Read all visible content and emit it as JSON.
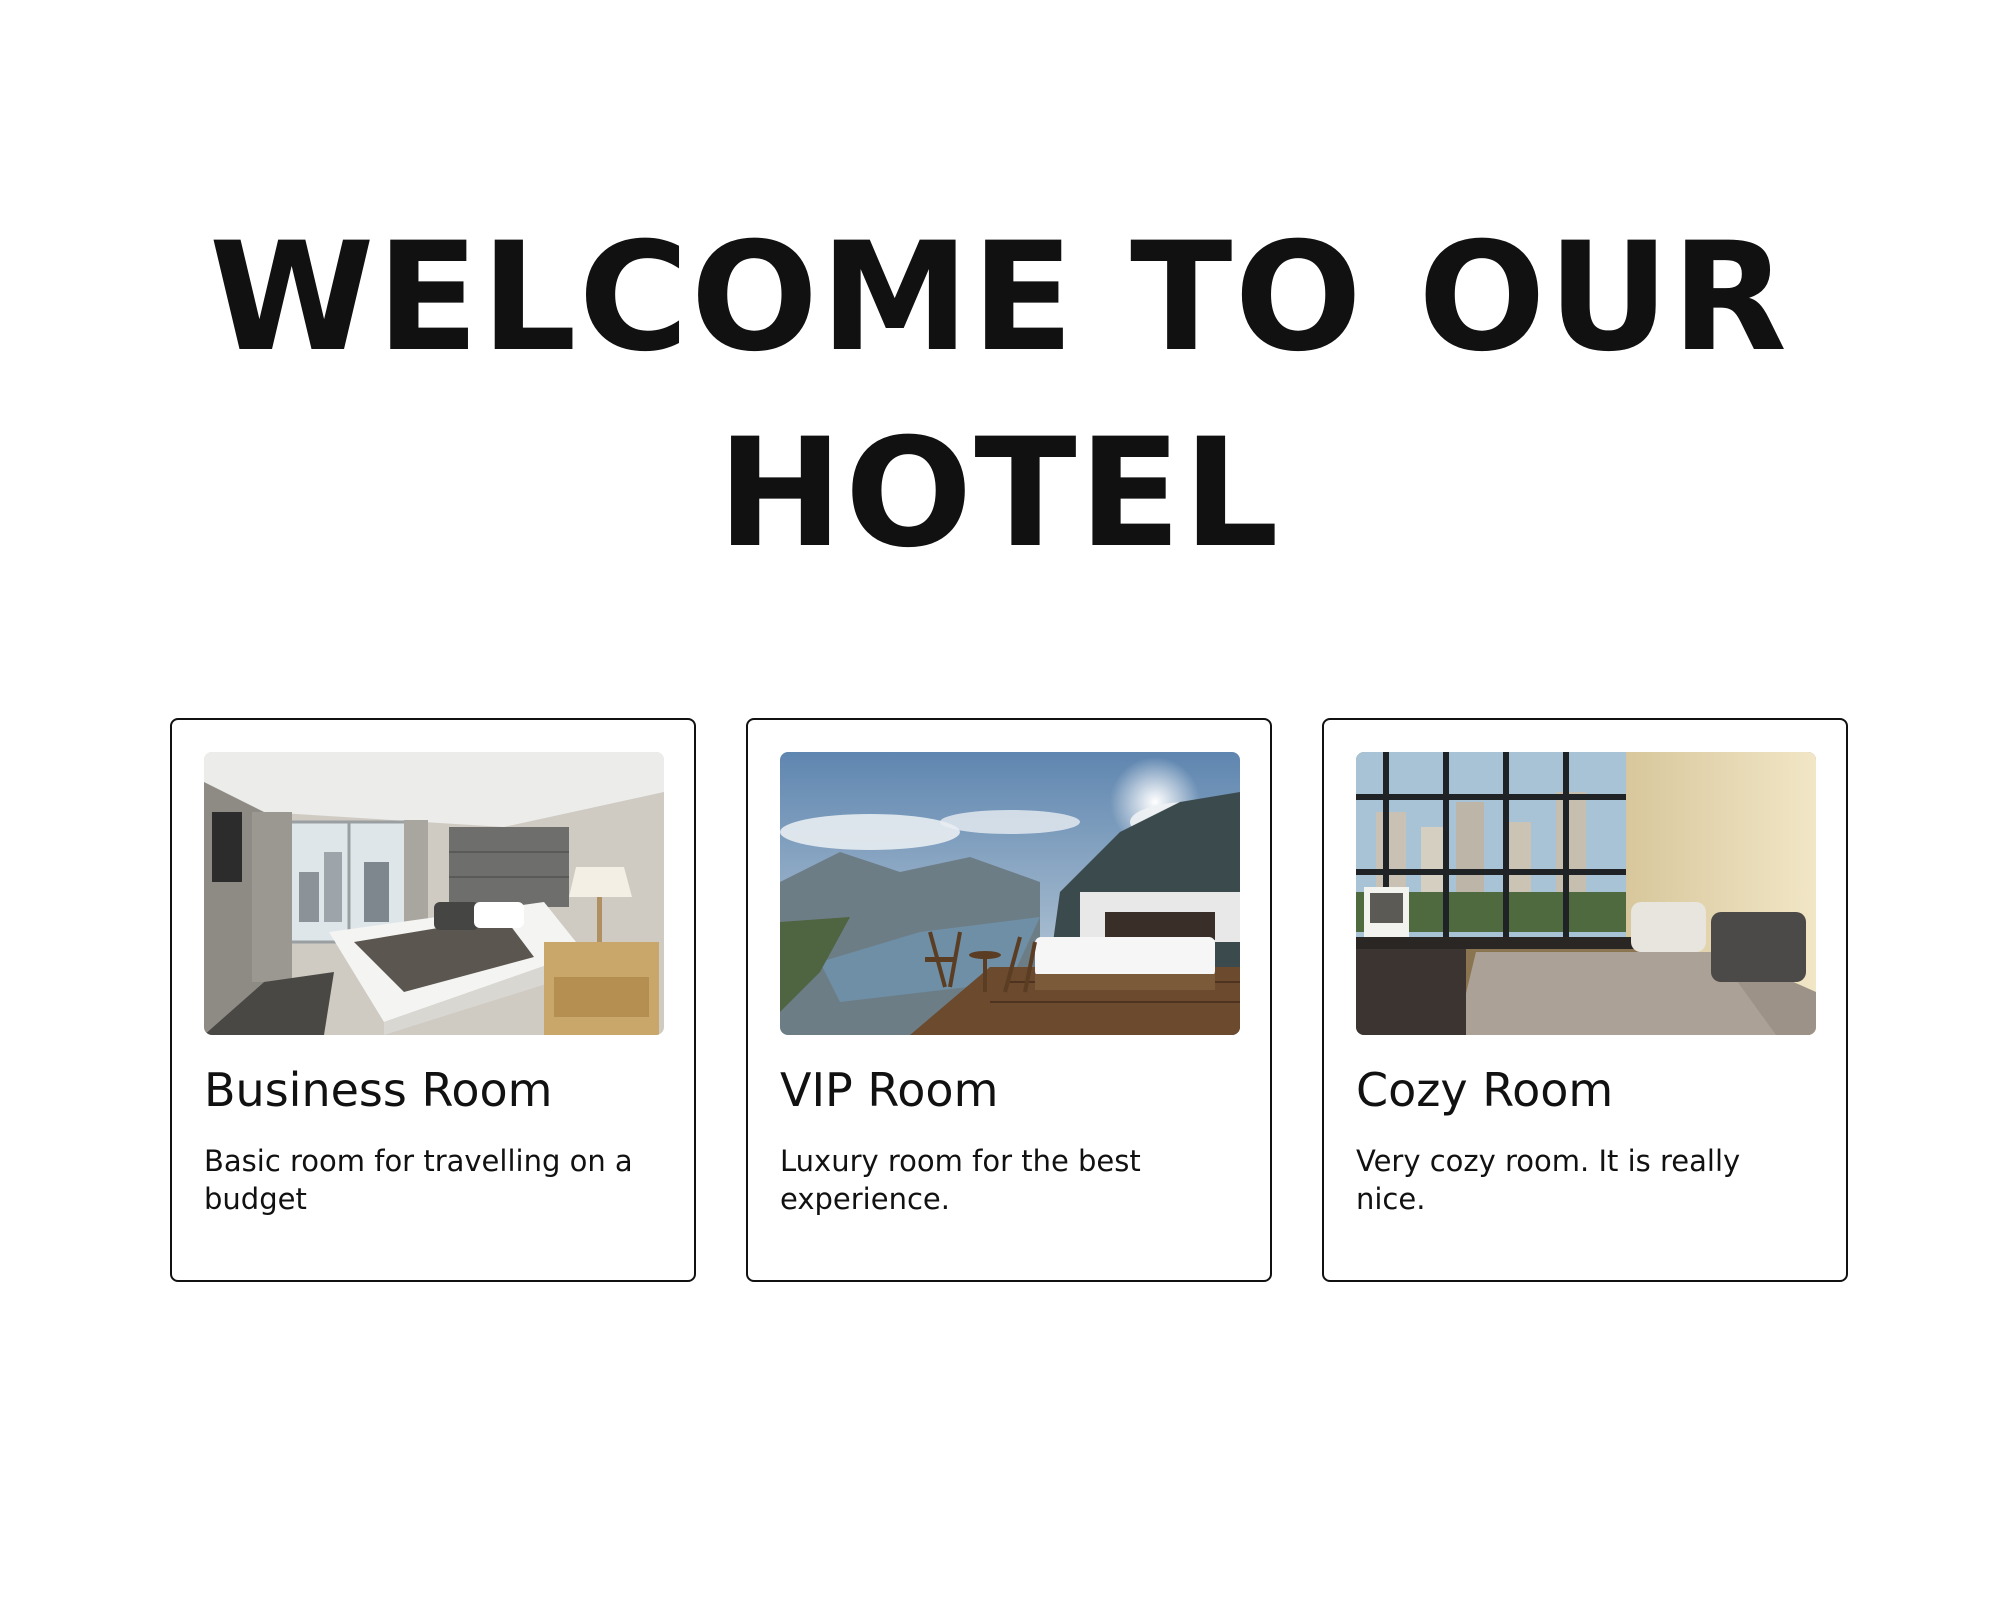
{
  "page": {
    "heading": "WELCOME TO OUR HOTEL"
  },
  "rooms": [
    {
      "title": "Business Room",
      "description": "Basic room for travelling on a budget",
      "image": "business-room-photo"
    },
    {
      "title": "VIP Room",
      "description": "Luxury room for the best experience.",
      "image": "vip-room-photo"
    },
    {
      "title": "Cozy Room",
      "description": "Very cozy room. It is really nice.",
      "image": "cozy-room-photo"
    }
  ],
  "colors": {
    "text": "#111111",
    "background": "#ffffff",
    "card_border": "#111111"
  }
}
